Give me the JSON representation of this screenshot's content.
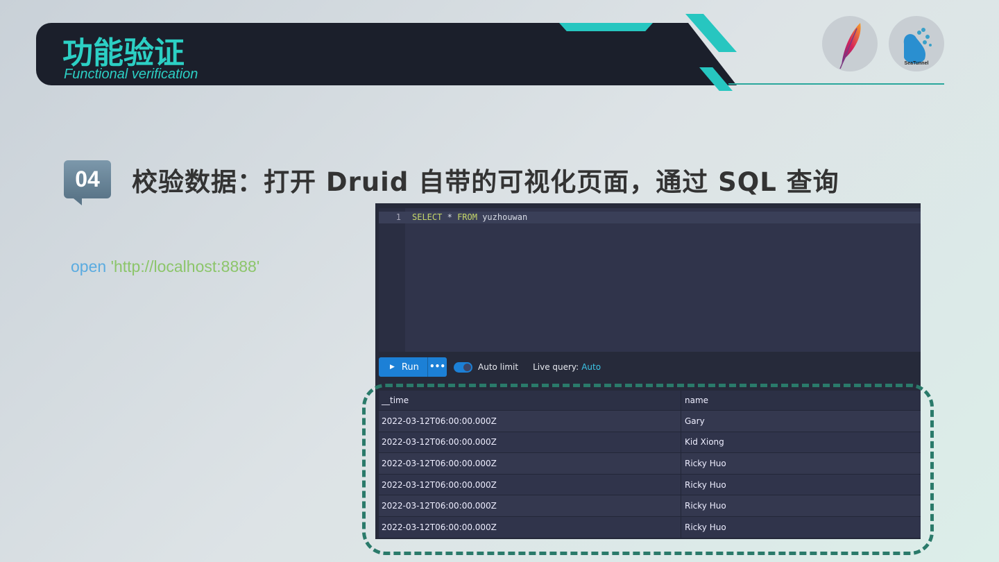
{
  "header": {
    "title": "功能验证",
    "subtitle": "Functional verification",
    "logos": [
      "apache-feather-logo",
      "seatunnel-logo"
    ],
    "seatunnel_text": "SeaTunnel"
  },
  "step": {
    "number": "04",
    "heading": "校验数据：打开 Druid 自带的可视化页面，通过 SQL 查询"
  },
  "command": {
    "keyword": "open",
    "arg": "'http://localhost:8888'"
  },
  "druid": {
    "editor": {
      "line_number": "1",
      "kw1": "SELECT",
      "star": "*",
      "kw2": "FROM",
      "table": "yuzhouwan"
    },
    "toolbar": {
      "run_label": "Run",
      "more_label": "•••",
      "auto_limit_label": "Auto limit",
      "auto_limit_on": true,
      "live_query_label": "Live query:",
      "live_query_value": "Auto"
    },
    "results": {
      "columns": [
        "__time",
        "name"
      ],
      "rows": [
        [
          "2022-03-12T06:00:00.000Z",
          "Gary"
        ],
        [
          "2022-03-12T06:00:00.000Z",
          "Kid Xiong"
        ],
        [
          "2022-03-12T06:00:00.000Z",
          "Ricky Huo"
        ],
        [
          "2022-03-12T06:00:00.000Z",
          "Ricky Huo"
        ],
        [
          "2022-03-12T06:00:00.000Z",
          "Ricky Huo"
        ],
        [
          "2022-03-12T06:00:00.000Z",
          "Ricky Huo"
        ]
      ]
    }
  },
  "colors": {
    "accent": "#27c6c0",
    "run_button": "#1c80d6",
    "dash_outline": "#2a7a6a"
  }
}
